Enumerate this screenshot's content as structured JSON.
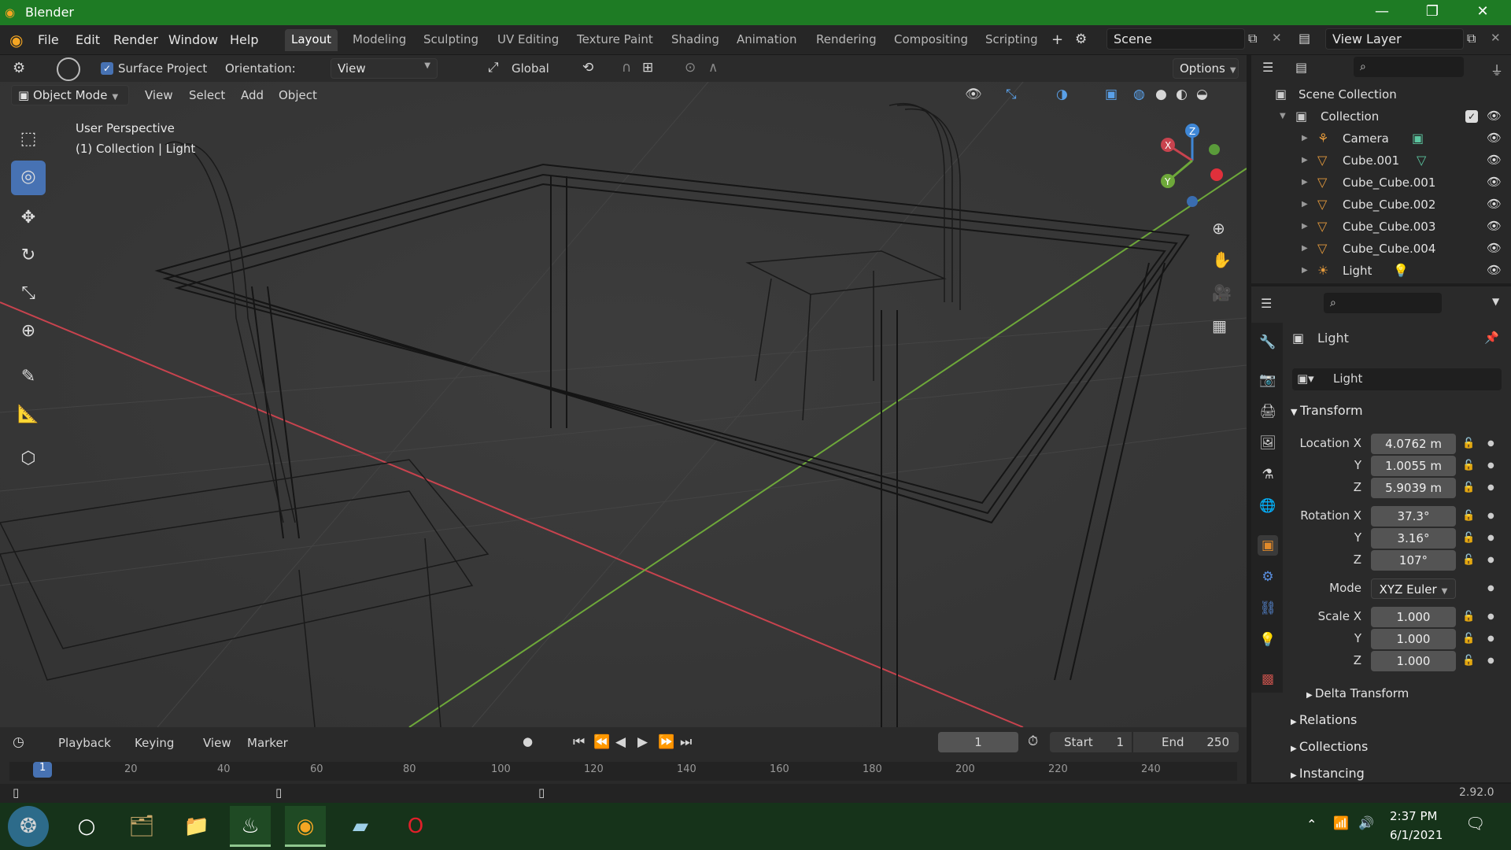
{
  "window": {
    "title": "Blender"
  },
  "menu": [
    "File",
    "Edit",
    "Render",
    "Window",
    "Help"
  ],
  "workspaces": [
    "Layout",
    "Modeling",
    "Sculpting",
    "UV Editing",
    "Texture Paint",
    "Shading",
    "Animation",
    "Rendering",
    "Compositing",
    "Scripting"
  ],
  "scene": "Scene",
  "view_layer": "View Layer",
  "tool_header": {
    "surface_project": "Surface Project",
    "orientation_label": "Orientation:",
    "orientation_value": "View",
    "transform_orientation": "Global",
    "options": "Options"
  },
  "viewport_header": {
    "mode": "Object Mode",
    "menus": [
      "View",
      "Select",
      "Add",
      "Object"
    ]
  },
  "viewport": {
    "perspective": "User Perspective",
    "context": "(1) Collection | Light"
  },
  "gizmo": {
    "x": "X",
    "y": "Y",
    "z": "Z"
  },
  "outliner": {
    "root": "Scene Collection",
    "collection": "Collection",
    "items": [
      "Camera",
      "Cube.001",
      "Cube_Cube.001",
      "Cube_Cube.002",
      "Cube_Cube.003",
      "Cube_Cube.004",
      "Light"
    ]
  },
  "properties": {
    "object_name": "Light",
    "data_name": "Light",
    "transform_title": "Transform",
    "location": {
      "label_x": "Location X",
      "x": "4.0762 m",
      "y": "1.0055 m",
      "z": "5.9039 m"
    },
    "rotation": {
      "label_x": "Rotation X",
      "x": "37.3°",
      "y": "3.16°",
      "z": "107°"
    },
    "mode_label": "Mode",
    "mode": "XYZ Euler",
    "scale": {
      "label_x": "Scale X",
      "x": "1.000",
      "y": "1.000",
      "z": "1.000"
    },
    "axis_y": "Y",
    "axis_z": "Z",
    "sections": [
      "Delta Transform",
      "Relations",
      "Collections",
      "Instancing"
    ]
  },
  "timeline": {
    "menus": [
      "Playback",
      "Keying",
      "View",
      "Marker"
    ],
    "current_frame": "1",
    "start_label": "Start",
    "start": "1",
    "end_label": "End",
    "end": "250",
    "ticks": [
      "1",
      "20",
      "40",
      "60",
      "80",
      "100",
      "120",
      "140",
      "160",
      "180",
      "200",
      "220",
      "240"
    ]
  },
  "status": {
    "version": "2.92.0"
  },
  "taskbar": {
    "time": "2:37 PM",
    "date": "6/1/2021"
  },
  "colors": {
    "accent": "#4772b3",
    "titlebar": "#1e7b24",
    "x_axis": "#c8434e",
    "y_axis": "#6ea83a",
    "z_axis": "#3f87d6"
  }
}
